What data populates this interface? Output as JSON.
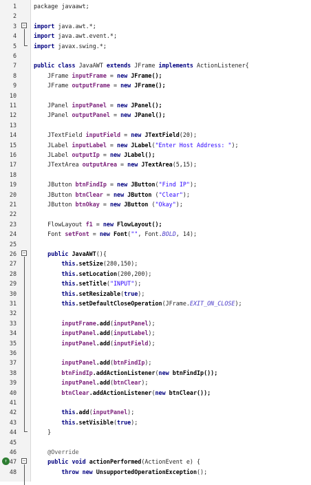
{
  "lines": [
    {
      "n": "1",
      "segs": [
        {
          "t": "package javaawt;",
          "c": ""
        }
      ]
    },
    {
      "n": "2",
      "segs": []
    },
    {
      "n": "3",
      "segs": [
        {
          "t": "import ",
          "c": "kw"
        },
        {
          "t": "java.awt.*;",
          "c": ""
        }
      ],
      "fold": "open"
    },
    {
      "n": "4",
      "segs": [
        {
          "t": "import ",
          "c": "kw"
        },
        {
          "t": "java.awt.event.*;",
          "c": ""
        }
      ]
    },
    {
      "n": "5",
      "segs": [
        {
          "t": "import ",
          "c": "kw"
        },
        {
          "t": "javax.swing.*;",
          "c": ""
        }
      ]
    },
    {
      "n": "6",
      "segs": []
    },
    {
      "n": "7",
      "segs": [
        {
          "t": "public class ",
          "c": "kw"
        },
        {
          "t": "JavaAWT ",
          "c": ""
        },
        {
          "t": "extends ",
          "c": "kw"
        },
        {
          "t": "JFrame ",
          "c": ""
        },
        {
          "t": "implements ",
          "c": "kw"
        },
        {
          "t": "ActionListener{",
          "c": ""
        }
      ]
    },
    {
      "n": "8",
      "segs": [
        {
          "t": "    JFrame ",
          "c": ""
        },
        {
          "t": "inputFrame",
          "c": "fld"
        },
        {
          "t": " = ",
          "c": ""
        },
        {
          "t": "new ",
          "c": "kw"
        },
        {
          "t": "JFrame();",
          "c": "mth"
        }
      ]
    },
    {
      "n": "9",
      "segs": [
        {
          "t": "    JFrame ",
          "c": ""
        },
        {
          "t": "outputFrame",
          "c": "fld"
        },
        {
          "t": " = ",
          "c": ""
        },
        {
          "t": "new ",
          "c": "kw"
        },
        {
          "t": "JFrame();",
          "c": "mth"
        }
      ]
    },
    {
      "n": "10",
      "segs": []
    },
    {
      "n": "11",
      "segs": [
        {
          "t": "    JPanel ",
          "c": ""
        },
        {
          "t": "inputPanel",
          "c": "fld"
        },
        {
          "t": " = ",
          "c": ""
        },
        {
          "t": "new ",
          "c": "kw"
        },
        {
          "t": "JPanel();",
          "c": "mth"
        }
      ]
    },
    {
      "n": "12",
      "segs": [
        {
          "t": "    JPanel ",
          "c": ""
        },
        {
          "t": "outputPanel",
          "c": "fld"
        },
        {
          "t": " = ",
          "c": ""
        },
        {
          "t": "new ",
          "c": "kw"
        },
        {
          "t": "JPanel();",
          "c": "mth"
        }
      ]
    },
    {
      "n": "13",
      "segs": []
    },
    {
      "n": "14",
      "segs": [
        {
          "t": "    JTextField ",
          "c": ""
        },
        {
          "t": "inputField",
          "c": "fld"
        },
        {
          "t": " = ",
          "c": ""
        },
        {
          "t": "new ",
          "c": "kw"
        },
        {
          "t": "JTextField",
          "c": "mth"
        },
        {
          "t": "(20);",
          "c": ""
        }
      ]
    },
    {
      "n": "15",
      "segs": [
        {
          "t": "    JLabel ",
          "c": ""
        },
        {
          "t": "inputLabel",
          "c": "fld"
        },
        {
          "t": " = ",
          "c": ""
        },
        {
          "t": "new ",
          "c": "kw"
        },
        {
          "t": "JLabel",
          "c": "mth"
        },
        {
          "t": "(",
          "c": ""
        },
        {
          "t": "\"Enter Host Address: \"",
          "c": "str"
        },
        {
          "t": ");",
          "c": ""
        }
      ]
    },
    {
      "n": "16",
      "segs": [
        {
          "t": "    JLabel ",
          "c": ""
        },
        {
          "t": "outputIp",
          "c": "fld"
        },
        {
          "t": " = ",
          "c": ""
        },
        {
          "t": "new ",
          "c": "kw"
        },
        {
          "t": "JLabel();",
          "c": "mth"
        }
      ]
    },
    {
      "n": "17",
      "segs": [
        {
          "t": "    JTextArea ",
          "c": ""
        },
        {
          "t": "outputArea",
          "c": "fld"
        },
        {
          "t": " = ",
          "c": ""
        },
        {
          "t": "new ",
          "c": "kw"
        },
        {
          "t": "JTextArea",
          "c": "mth"
        },
        {
          "t": "(5,15);",
          "c": ""
        }
      ]
    },
    {
      "n": "18",
      "segs": []
    },
    {
      "n": "19",
      "segs": [
        {
          "t": "    JButton ",
          "c": ""
        },
        {
          "t": "btnFindIp",
          "c": "fld"
        },
        {
          "t": " = ",
          "c": ""
        },
        {
          "t": "new ",
          "c": "kw"
        },
        {
          "t": "JButton",
          "c": "mth"
        },
        {
          "t": "(",
          "c": ""
        },
        {
          "t": "\"Find IP\"",
          "c": "str"
        },
        {
          "t": ");",
          "c": ""
        }
      ]
    },
    {
      "n": "20",
      "segs": [
        {
          "t": "    JButton ",
          "c": ""
        },
        {
          "t": "btnClear",
          "c": "fld"
        },
        {
          "t": " = ",
          "c": ""
        },
        {
          "t": "new ",
          "c": "kw"
        },
        {
          "t": "JButton ",
          "c": "mth"
        },
        {
          "t": "(",
          "c": ""
        },
        {
          "t": "\"Clear\"",
          "c": "str"
        },
        {
          "t": ");",
          "c": ""
        }
      ]
    },
    {
      "n": "21",
      "segs": [
        {
          "t": "    JButton ",
          "c": ""
        },
        {
          "t": "btnOkay",
          "c": "fld"
        },
        {
          "t": " = ",
          "c": ""
        },
        {
          "t": "new ",
          "c": "kw"
        },
        {
          "t": "JButton ",
          "c": "mth"
        },
        {
          "t": "(",
          "c": ""
        },
        {
          "t": "\"Okay\"",
          "c": "str"
        },
        {
          "t": ");",
          "c": ""
        }
      ]
    },
    {
      "n": "22",
      "segs": []
    },
    {
      "n": "23",
      "segs": [
        {
          "t": "    FlowLayout ",
          "c": ""
        },
        {
          "t": "f1",
          "c": "fld"
        },
        {
          "t": " = ",
          "c": ""
        },
        {
          "t": "new ",
          "c": "kw"
        },
        {
          "t": "FlowLayout();",
          "c": "mth"
        }
      ]
    },
    {
      "n": "24",
      "segs": [
        {
          "t": "    Font ",
          "c": ""
        },
        {
          "t": "setFont",
          "c": "fld"
        },
        {
          "t": " = ",
          "c": ""
        },
        {
          "t": "new ",
          "c": "kw"
        },
        {
          "t": "Font",
          "c": "mth"
        },
        {
          "t": "(",
          "c": ""
        },
        {
          "t": "\"\"",
          "c": "str"
        },
        {
          "t": ", Font.",
          "c": ""
        },
        {
          "t": "BOLD",
          "c": "const"
        },
        {
          "t": ", 14);",
          "c": ""
        }
      ]
    },
    {
      "n": "25",
      "segs": []
    },
    {
      "n": "26",
      "segs": [
        {
          "t": "    ",
          "c": ""
        },
        {
          "t": "public ",
          "c": "kw"
        },
        {
          "t": "JavaAWT",
          "c": "mth"
        },
        {
          "t": "(){",
          "c": ""
        }
      ],
      "fold": "open"
    },
    {
      "n": "27",
      "segs": [
        {
          "t": "        ",
          "c": ""
        },
        {
          "t": "this",
          "c": "kw"
        },
        {
          "t": ".setSize",
          "c": "mth"
        },
        {
          "t": "(280,150);",
          "c": ""
        }
      ]
    },
    {
      "n": "28",
      "segs": [
        {
          "t": "        ",
          "c": ""
        },
        {
          "t": "this",
          "c": "kw"
        },
        {
          "t": ".setLocation",
          "c": "mth"
        },
        {
          "t": "(200,200);",
          "c": ""
        }
      ]
    },
    {
      "n": "29",
      "segs": [
        {
          "t": "        ",
          "c": ""
        },
        {
          "t": "this",
          "c": "kw"
        },
        {
          "t": ".setTitle",
          "c": "mth"
        },
        {
          "t": "(",
          "c": ""
        },
        {
          "t": "\"INPUT\"",
          "c": "str"
        },
        {
          "t": ");",
          "c": ""
        }
      ]
    },
    {
      "n": "30",
      "segs": [
        {
          "t": "        ",
          "c": ""
        },
        {
          "t": "this",
          "c": "kw"
        },
        {
          "t": ".setResizable",
          "c": "mth"
        },
        {
          "t": "(",
          "c": ""
        },
        {
          "t": "true",
          "c": "kw"
        },
        {
          "t": ");",
          "c": ""
        }
      ]
    },
    {
      "n": "31",
      "segs": [
        {
          "t": "        ",
          "c": ""
        },
        {
          "t": "this",
          "c": "kw"
        },
        {
          "t": ".setDefaultCloseOperation",
          "c": "mth"
        },
        {
          "t": "(JFrame.",
          "c": ""
        },
        {
          "t": "EXIT_ON_CLOSE",
          "c": "const"
        },
        {
          "t": ");",
          "c": ""
        }
      ]
    },
    {
      "n": "32",
      "segs": []
    },
    {
      "n": "33",
      "segs": [
        {
          "t": "        ",
          "c": ""
        },
        {
          "t": "inputFrame",
          "c": "fld"
        },
        {
          "t": ".add",
          "c": "mth"
        },
        {
          "t": "(",
          "c": ""
        },
        {
          "t": "inputPanel",
          "c": "fld"
        },
        {
          "t": ");",
          "c": ""
        }
      ]
    },
    {
      "n": "34",
      "segs": [
        {
          "t": "        ",
          "c": ""
        },
        {
          "t": "inputPanel",
          "c": "fld"
        },
        {
          "t": ".add",
          "c": "mth"
        },
        {
          "t": "(",
          "c": ""
        },
        {
          "t": "inputLabel",
          "c": "fld"
        },
        {
          "t": ");",
          "c": ""
        }
      ]
    },
    {
      "n": "35",
      "segs": [
        {
          "t": "        ",
          "c": ""
        },
        {
          "t": "inputPanel",
          "c": "fld"
        },
        {
          "t": ".add",
          "c": "mth"
        },
        {
          "t": "(",
          "c": ""
        },
        {
          "t": "inputField",
          "c": "fld"
        },
        {
          "t": ");",
          "c": ""
        }
      ]
    },
    {
      "n": "36",
      "segs": []
    },
    {
      "n": "37",
      "segs": [
        {
          "t": "        ",
          "c": ""
        },
        {
          "t": "inputPanel",
          "c": "fld"
        },
        {
          "t": ".add",
          "c": "mth"
        },
        {
          "t": "(",
          "c": ""
        },
        {
          "t": "btnFindIp",
          "c": "fld"
        },
        {
          "t": ");",
          "c": ""
        }
      ]
    },
    {
      "n": "38",
      "segs": [
        {
          "t": "        ",
          "c": ""
        },
        {
          "t": "btnFindIp",
          "c": "fld"
        },
        {
          "t": ".addActionListener",
          "c": "mth"
        },
        {
          "t": "(",
          "c": ""
        },
        {
          "t": "new ",
          "c": "kw"
        },
        {
          "t": "btnFindIp());",
          "c": "mth"
        }
      ]
    },
    {
      "n": "39",
      "segs": [
        {
          "t": "        ",
          "c": ""
        },
        {
          "t": "inputPanel",
          "c": "fld"
        },
        {
          "t": ".add",
          "c": "mth"
        },
        {
          "t": "(",
          "c": ""
        },
        {
          "t": "btnClear",
          "c": "fld"
        },
        {
          "t": ");",
          "c": ""
        }
      ]
    },
    {
      "n": "40",
      "segs": [
        {
          "t": "        ",
          "c": ""
        },
        {
          "t": "btnClear",
          "c": "fld"
        },
        {
          "t": ".addActionListener",
          "c": "mth"
        },
        {
          "t": "(",
          "c": ""
        },
        {
          "t": "new ",
          "c": "kw"
        },
        {
          "t": "btnClear());",
          "c": "mth"
        }
      ]
    },
    {
      "n": "41",
      "segs": []
    },
    {
      "n": "42",
      "segs": [
        {
          "t": "        ",
          "c": ""
        },
        {
          "t": "this",
          "c": "kw"
        },
        {
          "t": ".add",
          "c": "mth"
        },
        {
          "t": "(",
          "c": ""
        },
        {
          "t": "inputPanel",
          "c": "fld"
        },
        {
          "t": ");",
          "c": ""
        }
      ]
    },
    {
      "n": "43",
      "segs": [
        {
          "t": "        ",
          "c": ""
        },
        {
          "t": "this",
          "c": "kw"
        },
        {
          "t": ".setVisible",
          "c": "mth"
        },
        {
          "t": "(",
          "c": ""
        },
        {
          "t": "true",
          "c": "kw"
        },
        {
          "t": ");",
          "c": ""
        }
      ]
    },
    {
      "n": "44",
      "segs": [
        {
          "t": "    }",
          "c": ""
        }
      ]
    },
    {
      "n": "45",
      "segs": []
    },
    {
      "n": "46",
      "segs": [
        {
          "t": "    ",
          "c": ""
        },
        {
          "t": "@Override",
          "c": "ann"
        }
      ]
    },
    {
      "n": "47",
      "segs": [
        {
          "t": "    ",
          "c": ""
        },
        {
          "t": "public void ",
          "c": "kw"
        },
        {
          "t": "actionPerformed",
          "c": "mth"
        },
        {
          "t": "(ActionEvent e) {",
          "c": ""
        }
      ],
      "fold": "open",
      "marker": "override"
    },
    {
      "n": "48",
      "segs": [
        {
          "t": "        ",
          "c": ""
        },
        {
          "t": "throw new ",
          "c": "kw"
        },
        {
          "t": "UnsupportedOperationException",
          "c": "mth"
        },
        {
          "t": "();",
          "c": ""
        }
      ]
    }
  ],
  "gutter_icons": {
    "fold_open": "minus-box-icon",
    "override_marker": "override-arrow-icon"
  }
}
